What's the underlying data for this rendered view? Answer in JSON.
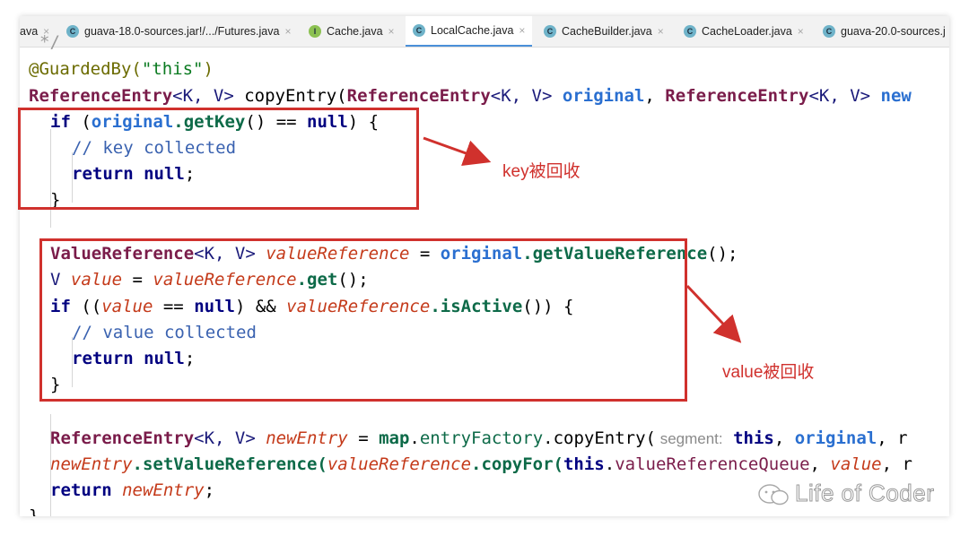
{
  "tabs": [
    {
      "label": "ava",
      "icon": "none",
      "closable": true,
      "active": false
    },
    {
      "label": "guava-18.0-sources.jar!/.../Futures.java",
      "icon": "C",
      "closable": true,
      "active": false
    },
    {
      "label": "Cache.java",
      "icon": "I",
      "closable": true,
      "active": false
    },
    {
      "label": "LocalCache.java",
      "icon": "C",
      "closable": true,
      "active": true
    },
    {
      "label": "CacheBuilder.java",
      "icon": "C",
      "closable": true,
      "active": false
    },
    {
      "label": "CacheLoader.java",
      "icon": "C",
      "closable": true,
      "active": false
    },
    {
      "label": "guava-20.0-sources.j",
      "icon": "C",
      "closable": false,
      "active": false
    }
  ],
  "close_glyph": "×",
  "code": {
    "l0": "*/",
    "l1_ann": "@GuardedBy(",
    "l1_str": "\"this\"",
    "l1_end": ")",
    "l2_type": "ReferenceEntry",
    "l2_gen": "<K, V>",
    "l2_method": " copyEntry(",
    "l2_ptype": "ReferenceEntry",
    "l2_pgen": "<K, V>",
    "l2_p1": " original",
    "l2_sep": ", ",
    "l2_ptype2": "ReferenceEntry",
    "l2_pgen2": "<K, V>",
    "l2_p2": " new",
    "l3_if": "if",
    "l3_a": " (",
    "l3_field": "original",
    "l3_m": ".getKey",
    "l3_b": "() == ",
    "l3_null": "null",
    "l3_c": ") {",
    "l4_comment": "// key collected",
    "l5_return": "return",
    "l5_null": " null",
    "l5_end": ";",
    "l6_brace": "}",
    "l7_type": "ValueReference",
    "l7_gen": "<K, V>",
    "l7_var": " valueReference",
    "l7_eq": " = ",
    "l7_field": "original",
    "l7_m": ".getValueReference",
    "l7_end": "();",
    "l8_v": "V",
    "l8_var": " value",
    "l8_eq": " = ",
    "l8_var2": "valueReference",
    "l8_m": ".get",
    "l8_end": "();",
    "l9_if": "if",
    "l9_a": " ((",
    "l9_var": "value",
    "l9_b": " == ",
    "l9_null": "null",
    "l9_c": ") && ",
    "l9_var2": "valueReference",
    "l9_m": ".isActive",
    "l9_d": "()) {",
    "l10_comment": "// value collected",
    "l11_return": "return",
    "l11_null": " null",
    "l11_end": ";",
    "l12_brace": "}",
    "l13_type": "ReferenceEntry",
    "l13_gen": "<K, V>",
    "l13_var": " newEntry",
    "l13_eq": " = ",
    "l13_map": "map",
    "l13_dot": ".",
    "l13_ef": "entryFactory",
    "l13_m": ".copyEntry(",
    "l13_hint": " segment:",
    "l13_this": " this",
    "l13_sep": ", ",
    "l13_field": "original",
    "l13_tail": ", r",
    "l14_var": "newEntry",
    "l14_m": ".setValueReference(",
    "l14_var2": "valueReference",
    "l14_m2": ".copyFor(",
    "l14_this": "this",
    "l14_dot": ".",
    "l14_field": "valueReferenceQueue",
    "l14_sep": ", ",
    "l14_var3": "value",
    "l14_tail": ", r",
    "l15_return": "return",
    "l15_var": " newEntry",
    "l15_end": ";",
    "l16_brace": "}"
  },
  "annotations": {
    "key_note": "key被回收",
    "value_note": "value被回收"
  },
  "watermark": "Life of Coder",
  "colors": {
    "highlight_box": "#d0312d",
    "active_tab_underline": "#4a90d9"
  }
}
